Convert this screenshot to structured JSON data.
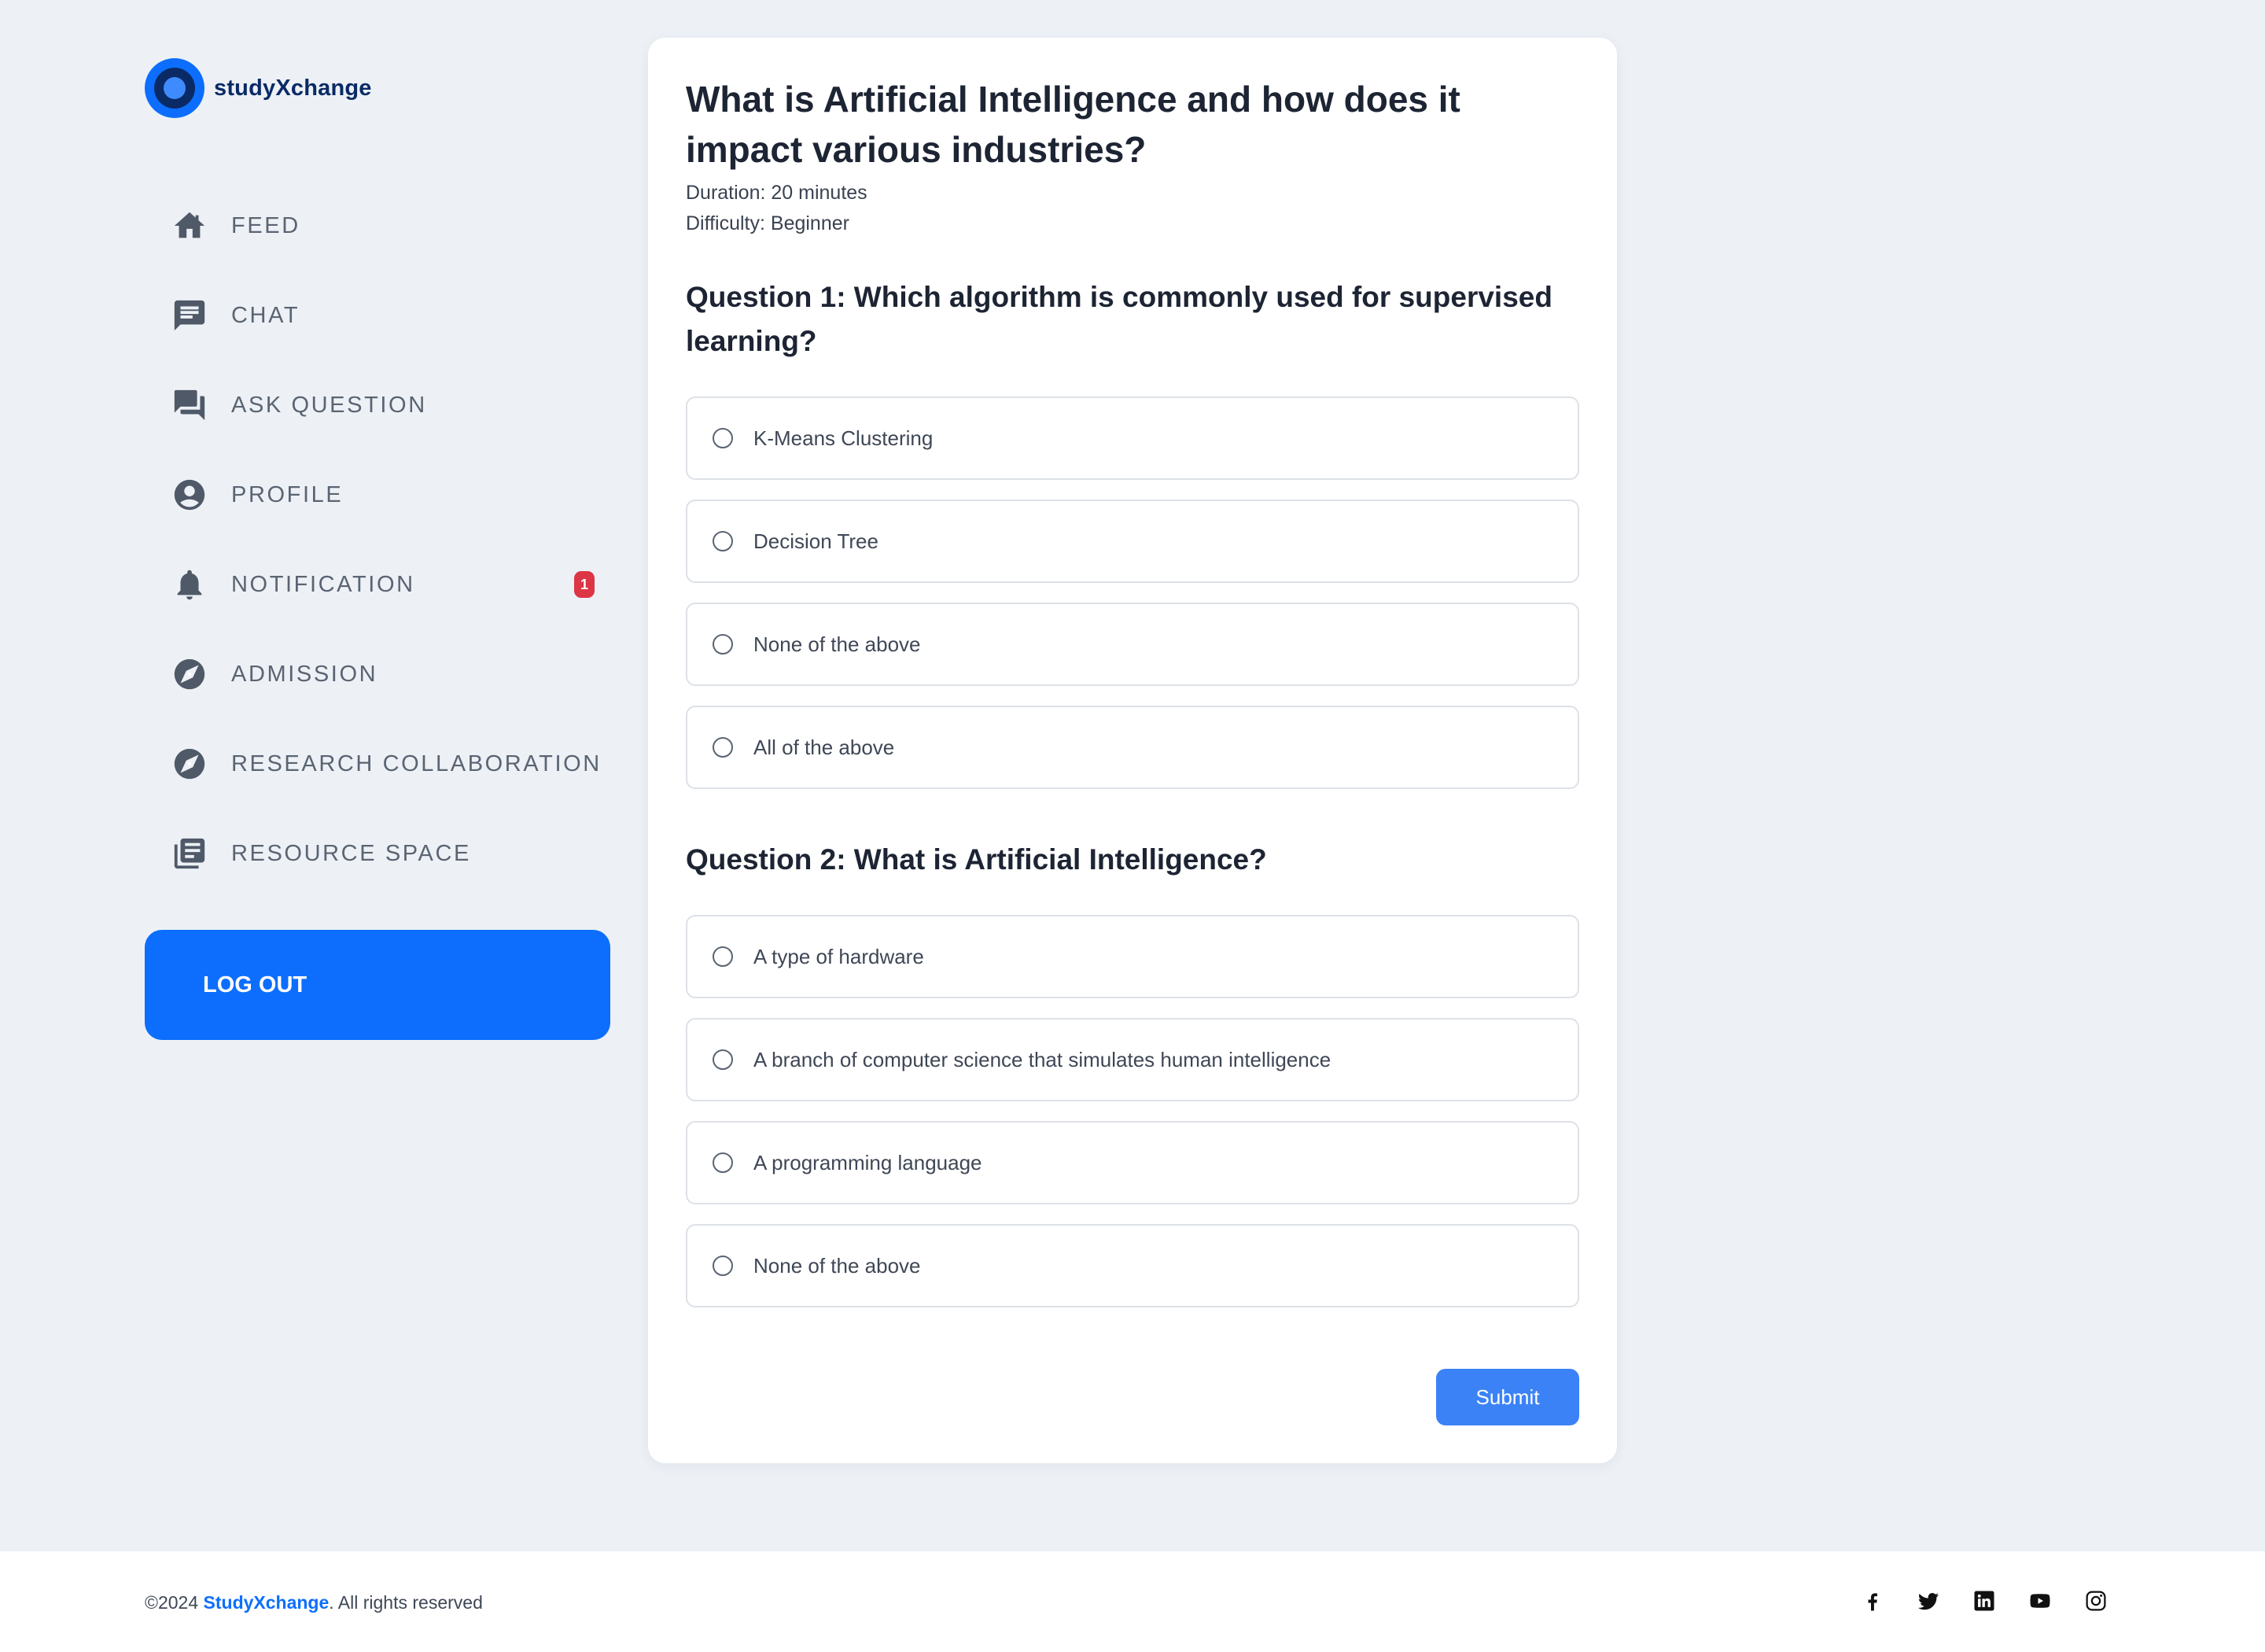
{
  "brand": {
    "name": "studyXchange",
    "logo_icon": "owl-logo-icon",
    "color": "#0d6efd"
  },
  "sidebar": {
    "items": [
      {
        "label": "FEED",
        "icon": "home-icon"
      },
      {
        "label": "CHAT",
        "icon": "chat-icon"
      },
      {
        "label": "ASK QUESTION",
        "icon": "forum-icon"
      },
      {
        "label": "PROFILE",
        "icon": "user-icon"
      },
      {
        "label": "NOTIFICATION",
        "icon": "bell-icon",
        "badge": "1"
      },
      {
        "label": "ADMISSION",
        "icon": "compass-icon"
      },
      {
        "label": "RESEARCH COLLABORATION",
        "icon": "compass-icon"
      },
      {
        "label": "RESOURCE SPACE",
        "icon": "library-icon"
      }
    ],
    "logout_label": "LOG OUT"
  },
  "quiz": {
    "title": "What is Artificial Intelligence and how does it impact various industries?",
    "duration": "Duration: 20 minutes",
    "difficulty": "Difficulty: Beginner",
    "questions": [
      {
        "title": "Question 1: Which algorithm is commonly used for supervised learning?",
        "options": [
          "K-Means Clustering",
          "Decision Tree",
          "None of the above",
          "All of the above"
        ]
      },
      {
        "title": "Question 2: What is Artificial Intelligence?",
        "options": [
          "A type of hardware",
          "A branch of computer science that simulates human intelligence",
          "A programming language",
          "None of the above"
        ]
      }
    ],
    "submit_label": "Submit"
  },
  "footer": {
    "copyright_prefix": "©2024 ",
    "copyright_brand": "StudyXchange",
    "copyright_suffix": ". All rights reserved",
    "social": [
      "facebook-icon",
      "twitter-icon",
      "linkedin-icon",
      "youtube-icon",
      "instagram-icon"
    ]
  },
  "colors": {
    "accent": "#0d6efd",
    "submit": "#3b82f6",
    "badge": "#dc3545",
    "background": "#edf1f6"
  }
}
